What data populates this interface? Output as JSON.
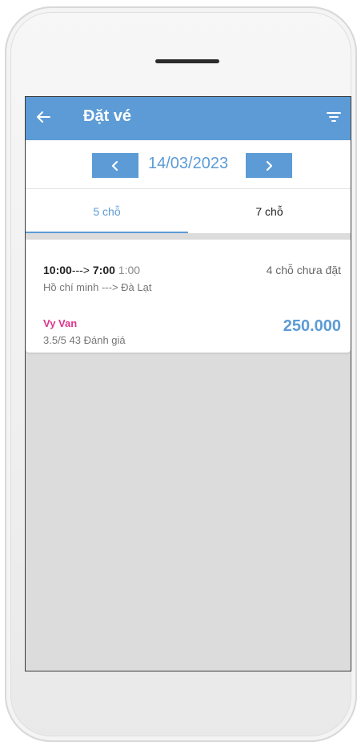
{
  "header": {
    "title": "Đặt vé",
    "back_icon": "arrow-left-icon",
    "filter_icon": "filter-icon"
  },
  "date": {
    "value": "14/03/2023",
    "prev_icon": "chevron-left-icon",
    "next_icon": "chevron-right-icon"
  },
  "tabs": [
    {
      "label": "5 chỗ",
      "active": true
    },
    {
      "label": "7 chỗ",
      "active": false
    }
  ],
  "trips": [
    {
      "depart": "10:00",
      "arrow": "--->",
      "arrive": "7:00",
      "duration": "1:00",
      "seats_left": "4 chỗ chưa đặt",
      "route": "Hồ chí minh ---> Đà Lạt",
      "driver": "Vy Van",
      "rating": "3.5/5",
      "reviews": "43 Đánh giá",
      "price": "250.000"
    }
  ],
  "colors": {
    "primary": "#5c9bd6",
    "driver": "#e0348b"
  }
}
